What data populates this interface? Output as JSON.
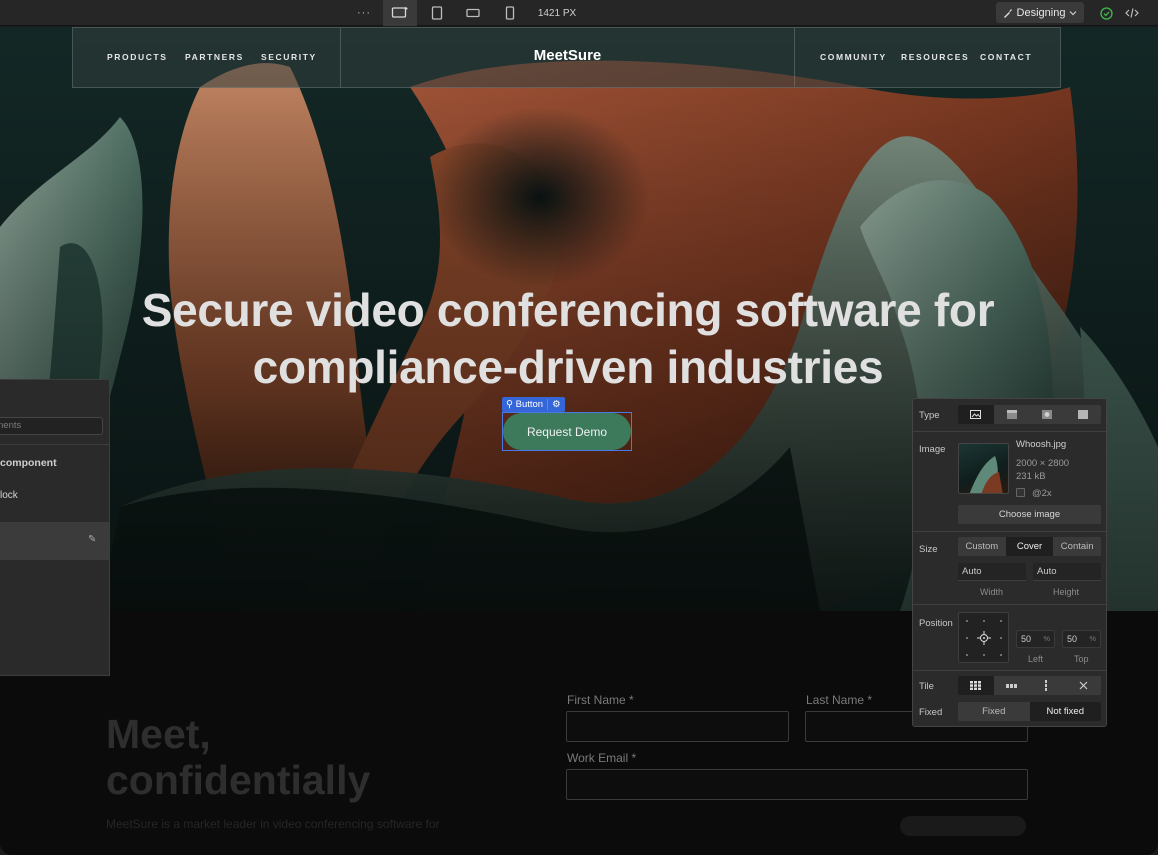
{
  "topbar": {
    "more_label": "···",
    "viewport_width": "1421 PX",
    "mode_label": "Designing",
    "devices": [
      "desktop-icon",
      "tablet-icon",
      "mobile-landscape-icon",
      "mobile-portrait-icon"
    ]
  },
  "site": {
    "nav_left": [
      "PRODUCTS",
      "PARTNERS",
      "SECURITY"
    ],
    "logo": "MeetSure",
    "nav_right": [
      "COMMUNITY",
      "RESOURCES",
      "CONTACT"
    ],
    "hero_title_line1": "Secure video conferencing software for",
    "hero_title_line2": "compliance-driven industries",
    "cta_label": "Request Demo",
    "selection_tag": "Button",
    "section_title_line1": "Meet,",
    "section_title_line2": "confidentially",
    "section_text": "MeetSure is a market leader in video conferencing software for",
    "form": {
      "first_name_label": "First Name *",
      "last_name_label": "Last Name  *",
      "work_email_label": "Work Email *"
    }
  },
  "left_panel": {
    "search_placeholder": "nents",
    "heading": "component",
    "item": "lock"
  },
  "bg_panel": {
    "type_label": "Type",
    "image_label": "Image",
    "file_name": "Whoosh.jpg",
    "dimensions": "2000 × 2800",
    "file_size": "231 kB",
    "retina_label": "@2x",
    "choose_label": "Choose image",
    "size_label": "Size",
    "size_options": [
      "Custom",
      "Cover",
      "Contain"
    ],
    "size_selected": "Cover",
    "width_value": "Auto",
    "height_value": "Auto",
    "width_caption": "Width",
    "height_caption": "Height",
    "position_label": "Position",
    "left_value": "50",
    "top_value": "50",
    "percent_unit": "%",
    "left_caption": "Left",
    "top_caption": "Top",
    "tile_label": "Tile",
    "fixed_label": "Fixed",
    "fixed_options": [
      "Fixed",
      "Not fixed"
    ],
    "fixed_selected": "Not fixed"
  },
  "colors": {
    "accent": "#3566d8",
    "cta": "#3d7a5c",
    "success": "#3fb950"
  }
}
